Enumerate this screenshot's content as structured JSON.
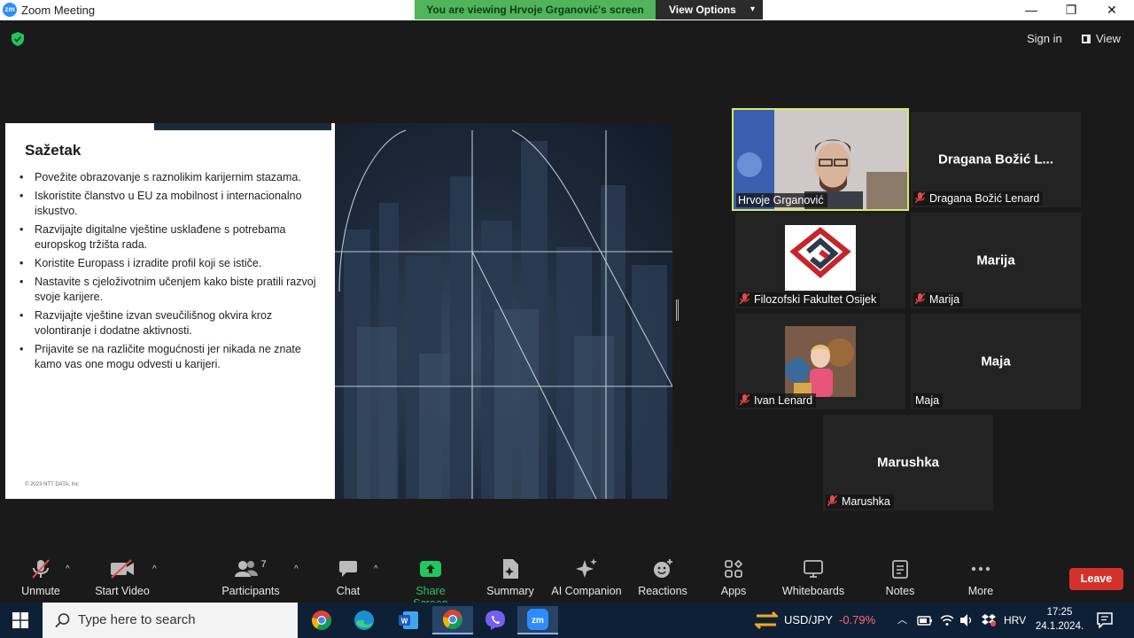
{
  "window": {
    "title": "Zoom Meeting",
    "app_icon_text": "zm",
    "viewing_banner": "You are viewing Hrvoje Grganović's screen",
    "view_options_label": "View Options",
    "minimize": "—",
    "restore": "❐",
    "close": "✕"
  },
  "meeting_header": {
    "sign_in": "Sign in",
    "view": "View"
  },
  "slide": {
    "title": "Sažetak",
    "bullets": [
      "Povežite obrazovanje s raznolikim karijernim stazama.",
      "Iskoristite članstvo u EU za mobilnost i internacionalno iskustvo.",
      "Razvijajte digitalne vještine usklađene s potrebama europskog tržišta rada.",
      "Koristite Europass i izradite profil koji se ističe.",
      "Nastavite s cjeloživotnim učenjem kako biste pratili razvoj svoje karijere.",
      "Razvijajte vještine izvan sveučilišnog okvira kroz volontiranje i dodatne aktivnosti.",
      "Prijavite se na različite mogućnosti jer nikada ne znate kamo vas one mogu odvesti u karijeri."
    ],
    "footer": "© 2023 NTT DATA, Inc"
  },
  "participants": [
    {
      "label": "Hrvoje Grganović",
      "center": "",
      "muted": false,
      "video": "person",
      "active": true
    },
    {
      "label": "Dragana Božić Lenard",
      "center": "Dragana Božić L...",
      "muted": true,
      "video": "none",
      "active": false
    },
    {
      "label": "Filozofski Fakultet Osijek",
      "center": "",
      "muted": true,
      "video": "logo",
      "active": false
    },
    {
      "label": "Marija",
      "center": "Marija",
      "muted": true,
      "video": "none",
      "active": false
    },
    {
      "label": "Ivan Lenard",
      "center": "",
      "muted": true,
      "video": "child",
      "active": false
    },
    {
      "label": "Maja",
      "center": "Maja",
      "muted": false,
      "video": "none",
      "active": false
    },
    {
      "label": "Marushka",
      "center": "Marushka",
      "muted": true,
      "video": "none",
      "active": false
    }
  ],
  "toolbar": {
    "unmute": "Unmute",
    "start_video": "Start Video",
    "participants": "Participants",
    "participants_count": "7",
    "chat": "Chat",
    "share_screen": "Share Screen",
    "summary": "Summary",
    "ai_companion": "AI Companion",
    "reactions": "Reactions",
    "apps": "Apps",
    "whiteboards": "Whiteboards",
    "notes": "Notes",
    "more": "More",
    "leave": "Leave",
    "caret": "^"
  },
  "colors": {
    "share_green": "#23c55e",
    "leave_red": "#d5312c",
    "banner_green": "#4fb45a",
    "mute_red": "#e5484d"
  },
  "taskbar": {
    "search_placeholder": "Type here to search",
    "apps": [
      "chrome-icon",
      "edge-icon",
      "word-icon",
      "chrome-profile-icon",
      "viber-icon",
      "zoom-icon"
    ],
    "ticker_symbol": "USD/JPY",
    "ticker_change": "-0.79%",
    "language": "HRV",
    "time": "17:25",
    "date": "24.1.2024."
  }
}
